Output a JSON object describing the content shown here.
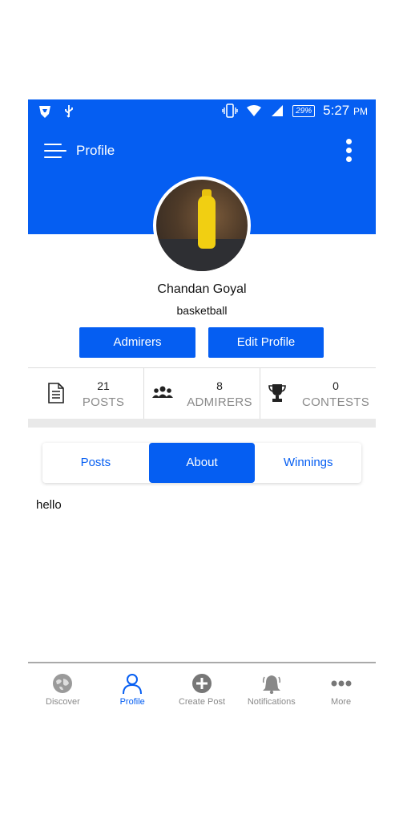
{
  "status_bar": {
    "battery": "29%",
    "time": "5:27",
    "ampm": "PM"
  },
  "appbar": {
    "title": "Profile"
  },
  "profile": {
    "name": "Chandan Goyal",
    "bio": "basketball"
  },
  "buttons": {
    "admirers": "Admirers",
    "edit_profile": "Edit Profile"
  },
  "stats": [
    {
      "value": "21",
      "label": "POSTS",
      "icon": "document-icon"
    },
    {
      "value": "8",
      "label": "ADMIRERS",
      "icon": "group-icon"
    },
    {
      "value": "0",
      "label": "CONTESTS",
      "icon": "trophy-icon"
    }
  ],
  "tabs": [
    {
      "label": "Posts",
      "active": false
    },
    {
      "label": "About",
      "active": true
    },
    {
      "label": "Winnings",
      "active": false
    }
  ],
  "about": {
    "text": "hello"
  },
  "bottom_nav": [
    {
      "label": "Discover",
      "icon": "globe-icon",
      "active": false
    },
    {
      "label": "Profile",
      "icon": "person-icon",
      "active": true
    },
    {
      "label": "Create Post",
      "icon": "plus-circle-icon",
      "active": false
    },
    {
      "label": "Notifications",
      "icon": "bell-icon",
      "active": false
    },
    {
      "label": "More",
      "icon": "more-dots-icon",
      "active": false
    }
  ],
  "colors": {
    "primary": "#055ef2",
    "muted": "#8a8a8a"
  }
}
